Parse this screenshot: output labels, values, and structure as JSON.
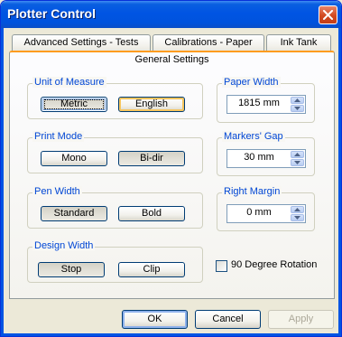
{
  "window": {
    "title": "Plotter Control"
  },
  "tabs": [
    {
      "label": "Advanced Settings - Tests"
    },
    {
      "label": "Calibrations - Paper"
    },
    {
      "label": "Ink Tank"
    },
    {
      "label": "General Settings"
    }
  ],
  "unit_of_measure": {
    "legend": "Unit of Measure",
    "metric": "Metric",
    "english": "English"
  },
  "print_mode": {
    "legend": "Print Mode",
    "mono": "Mono",
    "bidir": "Bi-dir"
  },
  "pen_width": {
    "legend": "Pen Width",
    "standard": "Standard",
    "bold": "Bold"
  },
  "design_width": {
    "legend": "Design Width",
    "stop": "Stop",
    "clip": "Clip"
  },
  "paper_width": {
    "legend": "Paper Width",
    "value": "1815 mm"
  },
  "markers_gap": {
    "legend": "Markers' Gap",
    "value": "30 mm"
  },
  "right_margin": {
    "legend": "Right Margin",
    "value": "0 mm"
  },
  "rotation": {
    "label": "90 Degree Rotation",
    "checked": false
  },
  "dialog_buttons": {
    "ok": "OK",
    "cancel": "Cancel",
    "apply": "Apply"
  }
}
